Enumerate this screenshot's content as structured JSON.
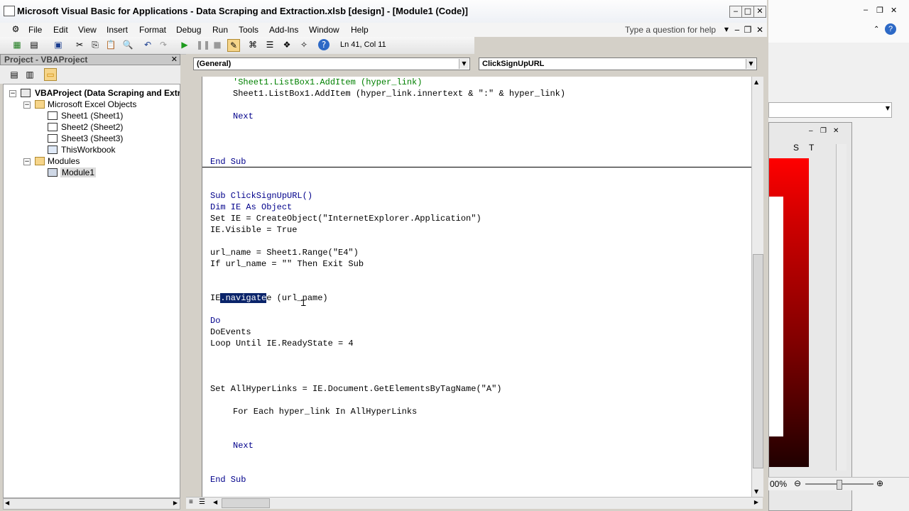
{
  "title": "Microsoft Visual Basic for Applications - Data Scraping and Extraction.xlsb [design] - [Module1 (Code)]",
  "menus": [
    "File",
    "Edit",
    "View",
    "Insert",
    "Format",
    "Debug",
    "Run",
    "Tools",
    "Add-Ins",
    "Window",
    "Help"
  ],
  "help_box": "Type a question for help",
  "cursor_position": "Ln 41, Col 11",
  "project": {
    "header": "Project - VBAProject",
    "root": "VBAProject (Data Scraping and Extra",
    "folder1": "Microsoft Excel Objects",
    "sheets": [
      "Sheet1 (Sheet1)",
      "Sheet2 (Sheet2)",
      "Sheet3 (Sheet3)",
      "ThisWorkbook"
    ],
    "folder2": "Modules",
    "module": "Module1"
  },
  "code_window": {
    "object_combo": "(General)",
    "procedure_combo": "ClickSignUpURL"
  },
  "code": {
    "l1": "'Sheet1.ListBox1.AddItem (hyper_link)",
    "l2": "Sheet1.ListBox1.AddItem (hyper_link.innertext & \":\" & hyper_link)",
    "l3": "Next",
    "l4": "End Sub",
    "l5": "Sub ClickSignUpURL()",
    "l6": "Dim IE As Object",
    "l7": "Set IE = CreateObject(\"InternetExplorer.Application\")",
    "l8": "IE.Visible = True",
    "l9": "url_name = Sheet1.Range(\"E4\")",
    "l10": "If url_name = \"\" Then Exit Sub",
    "l11a": "IE",
    "l11b": ".navigate",
    "l11c": "e (url_name)",
    "l12": "Do",
    "l13": "DoEvents",
    "l14": "Loop Until IE.ReadyState = 4",
    "l15": "Set AllHyperLinks = IE.Document.GetElementsByTagName(\"A\")",
    "l16": "For Each hyper_link In AllHyperLinks",
    "l17": "Next",
    "l18": "End Sub"
  },
  "excel_bg": {
    "col_s": "S",
    "col_t": "T",
    "zoom": "00%",
    "accent_red": "#e00000"
  }
}
